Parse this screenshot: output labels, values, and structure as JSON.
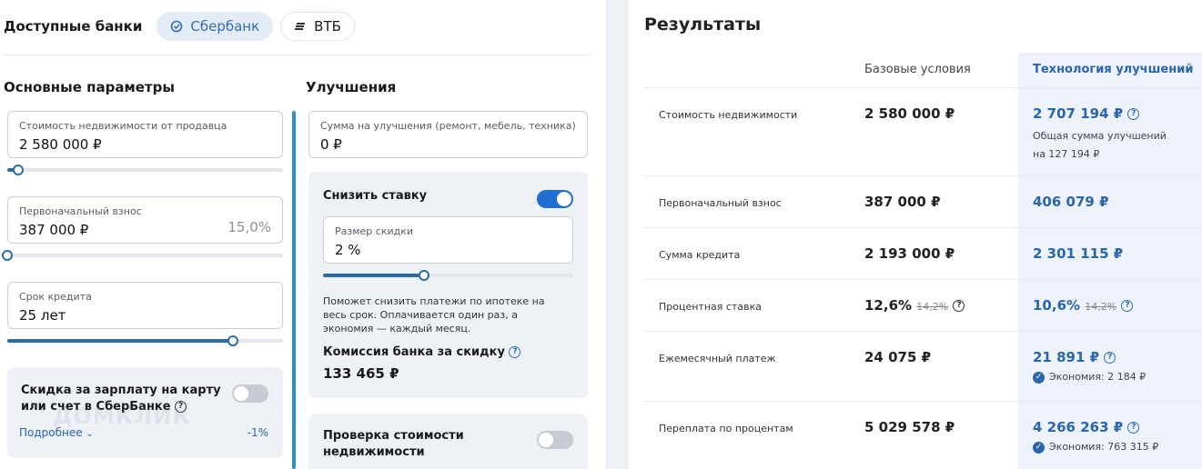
{
  "banks": {
    "title": "Доступные банки",
    "items": [
      {
        "label": "Сбербанк",
        "active": true
      },
      {
        "label": "ВТБ",
        "active": false
      }
    ]
  },
  "main": {
    "title": "Основные параметры",
    "price": {
      "label": "Стоимость недвижимости от продавца",
      "value": "2 580 000 ₽",
      "level": 0.02
    },
    "down": {
      "label": "Первоначальный взнос",
      "value": "387 000 ₽",
      "percent": "15,0%",
      "level": 0.0
    },
    "term": {
      "label": "Срок кредита",
      "value": "25 лет",
      "level": 0.83
    },
    "salary": {
      "title": "Скидка за зарплату на карту или счет в СберБанке",
      "more": "Подробнее",
      "discount": "-1%",
      "enabled": false
    }
  },
  "improvements": {
    "title": "Улучшения",
    "amount": {
      "label": "Сумма на улучшения (ремонт, мебель, техника)",
      "value": "0 ₽"
    },
    "reduce": {
      "title": "Снизить ставку",
      "enabled": true,
      "size_label": "Размер скидки",
      "size_value": "2 %",
      "level": 0.4,
      "description": "Поможет снизить платежи по ипотеке на весь срок. Оплачивается один раз, а экономия — каждый месяц.",
      "commission_label": "Комиссия банка за скидку",
      "commission_value": "133 465 ₽"
    },
    "check": {
      "title": "Проверка стоимости недвижимости",
      "enabled": false
    }
  },
  "watermark": "ДОМКЛИК",
  "results": {
    "title": "Результаты",
    "col_base": "Базовые условия",
    "col_tech": "Технология улучшений",
    "rows": [
      {
        "label": "Стоимость недвижимости",
        "base": "2 580 000 ₽",
        "tech": "2 707 194 ₽",
        "note": "Общая сумма улучшений на 127 194 ₽"
      },
      {
        "label": "Первоначальный взнос",
        "base": "387 000 ₽",
        "tech": "406 079 ₽"
      },
      {
        "label": "Сумма кредита",
        "base": "2 193 000 ₽",
        "tech": "2 301 115 ₽"
      },
      {
        "label": "Процентная ставка",
        "base": "12,6%",
        "base_old": "14,2%",
        "tech": "10,6%",
        "tech_old": "14,2%"
      },
      {
        "label": "Ежемесячный платеж",
        "base": "24 075 ₽",
        "tech": "21 891 ₽",
        "note": "Экономия: 2 184 ₽"
      },
      {
        "label": "Переплата по процентам",
        "base": "5 029 578 ₽",
        "tech": "4 266 263 ₽",
        "note": "Экономия: 763 315 ₽"
      }
    ]
  },
  "colors": {
    "accent": "#2b6ca6",
    "link": "#2a66ab",
    "toggle_on": "#1f6fd3"
  }
}
